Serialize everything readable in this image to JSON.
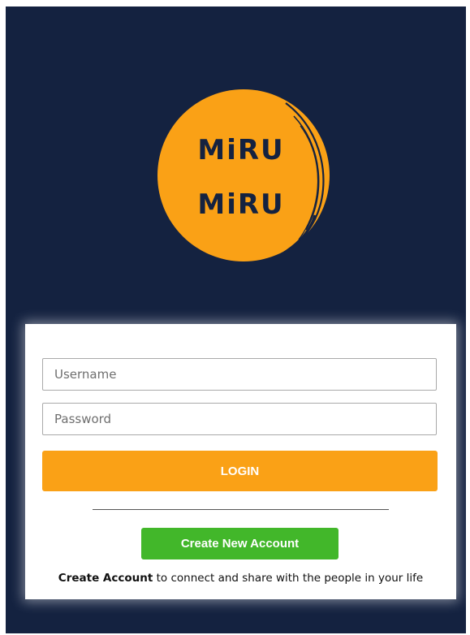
{
  "logo": {
    "line1": "MiRU",
    "line2": "MiRU",
    "circle_color": "#faa116",
    "text_color": "#142240"
  },
  "login_form": {
    "username_placeholder": "Username",
    "password_placeholder": "Password",
    "login_label": "LOGIN",
    "create_account_button_label": "Create New Account",
    "tagline_bold": "Create Account",
    "tagline_rest": " to connect and share with the people in your life"
  },
  "colors": {
    "background": "#142240",
    "login_button": "#faa116",
    "create_button": "#42b72a",
    "card": "#ffffff"
  }
}
